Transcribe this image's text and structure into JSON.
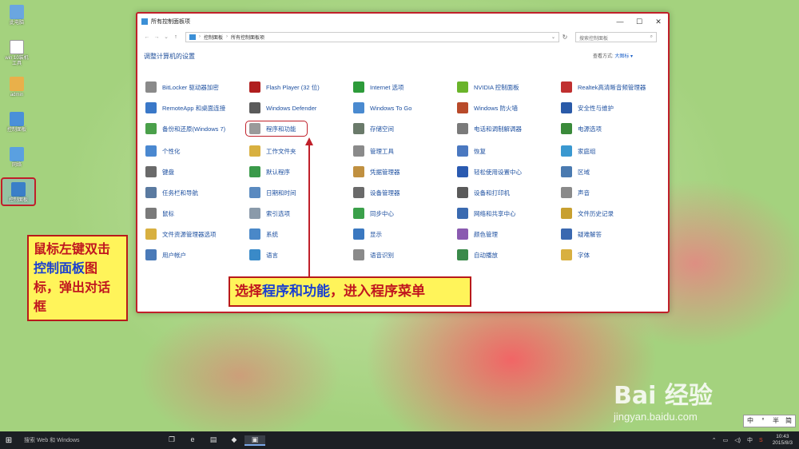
{
  "desktop_icons": [
    {
      "label": "此电脑",
      "color": "#6aa6e0"
    },
    {
      "label": "win 10装机工具",
      "color": "#ffffff"
    },
    {
      "label": "admin",
      "color": "#e9b04a"
    },
    {
      "label": "控制面板",
      "color": "#4a90d9"
    },
    {
      "label": "网络",
      "color": "#5aa0e0"
    },
    {
      "label": "控制面板",
      "color": "#3a7fc8"
    }
  ],
  "callout_left": {
    "p1": "鼠标左键双击",
    "p2": "控制面板",
    "p3": "图标，弹出对话框"
  },
  "callout_center": {
    "p1": "选择",
    "p2": "程序和功能",
    "p3": "，进入程序菜单"
  },
  "window": {
    "title": "所有控制面板项",
    "controls": {
      "min": "—",
      "max": "☐",
      "close": "✕"
    },
    "address": {
      "root": "控制面板",
      "current": "所有控制面板项"
    },
    "search_placeholder": "搜索控制面板",
    "heading": "调整计算机的设置",
    "view_by_label": "查看方式:",
    "view_by_value": "大图标 ▾"
  },
  "items": [
    {
      "label": "BitLocker 驱动器加密",
      "color": "#8a8a8a"
    },
    {
      "label": "Flash Player (32 位)",
      "color": "#b01e1e"
    },
    {
      "label": "Internet 选项",
      "color": "#2d9b3a"
    },
    {
      "label": "NVIDIA 控制面板",
      "color": "#6ab42a"
    },
    {
      "label": "Realtek高清晰音频管理器",
      "color": "#c03030"
    },
    {
      "label": "RemoteApp 和桌面连接",
      "color": "#3a78c8"
    },
    {
      "label": "Windows Defender",
      "color": "#5a5a5a"
    },
    {
      "label": "Windows To Go",
      "color": "#4a8ad0"
    },
    {
      "label": "Windows 防火墙",
      "color": "#b84a2a"
    },
    {
      "label": "安全性与维护",
      "color": "#2a5aa8"
    },
    {
      "label": "备份和还原(Windows 7)",
      "color": "#4aa04a"
    },
    {
      "label": "程序和功能",
      "color": "#9a9a9a"
    },
    {
      "label": "存储空间",
      "color": "#6a7a6a"
    },
    {
      "label": "电话和调制解调器",
      "color": "#7a7a7a"
    },
    {
      "label": "电源选项",
      "color": "#3a8a3a"
    },
    {
      "label": "个性化",
      "color": "#4a88d0"
    },
    {
      "label": "工作文件夹",
      "color": "#d8b040"
    },
    {
      "label": "管理工具",
      "color": "#8a8a8a"
    },
    {
      "label": "恢复",
      "color": "#4a78c0"
    },
    {
      "label": "家庭组",
      "color": "#3a98d0"
    },
    {
      "label": "键盘",
      "color": "#6a6a6a"
    },
    {
      "label": "默认程序",
      "color": "#3a9a4a"
    },
    {
      "label": "凭据管理器",
      "color": "#c09040"
    },
    {
      "label": "轻松使用设置中心",
      "color": "#2a5ab0"
    },
    {
      "label": "区域",
      "color": "#4a7ab0"
    },
    {
      "label": "任务栏和导航",
      "color": "#5a7aa0"
    },
    {
      "label": "日期和时间",
      "color": "#5a8ac0"
    },
    {
      "label": "设备管理器",
      "color": "#6a6a6a"
    },
    {
      "label": "设备和打印机",
      "color": "#5a5a5a"
    },
    {
      "label": "声音",
      "color": "#8a8a8a"
    },
    {
      "label": "鼠标",
      "color": "#7a7a7a"
    },
    {
      "label": "索引选项",
      "color": "#8a9aaa"
    },
    {
      "label": "同步中心",
      "color": "#3aa04a"
    },
    {
      "label": "网络和共享中心",
      "color": "#3a6ab0"
    },
    {
      "label": "文件历史记录",
      "color": "#c8a030"
    },
    {
      "label": "文件资源管理器选项",
      "color": "#d8b040"
    },
    {
      "label": "系统",
      "color": "#4a88c8"
    },
    {
      "label": "显示",
      "color": "#3a78c0"
    },
    {
      "label": "颜色管理",
      "color": "#8a5ab0"
    },
    {
      "label": "疑难解答",
      "color": "#3a68b0"
    },
    {
      "label": "用户帐户",
      "color": "#4a7ab8"
    },
    {
      "label": "语言",
      "color": "#3a8ac8"
    },
    {
      "label": "语音识别",
      "color": "#8a8a8a"
    },
    {
      "label": "自动播放",
      "color": "#3a8a4a"
    },
    {
      "label": "字体",
      "color": "#d8b040"
    }
  ],
  "highlighted_item_index": 11,
  "taskbar": {
    "start": "⊞",
    "search": "搜索 Web 和 Windows",
    "apps": [
      "❐",
      "e",
      "▤",
      "◆",
      "▣"
    ],
    "active_app_index": 4,
    "tray": [
      "⌃",
      "▭",
      "◁)",
      "中",
      "S"
    ],
    "time": "10:43",
    "date": "2015/8/3"
  },
  "ime": [
    "中",
    "°",
    "半",
    "简"
  ],
  "watermark": {
    "brand": "Bai 经验",
    "url": "jingyan.baidu.com"
  }
}
